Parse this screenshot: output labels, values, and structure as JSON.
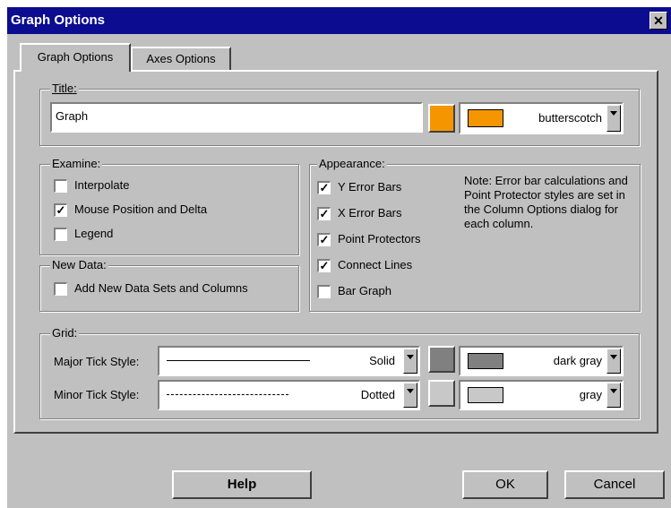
{
  "window": {
    "title": "Graph Options",
    "close_glyph": "✕"
  },
  "tabs": [
    {
      "label": "Graph Options",
      "active": true
    },
    {
      "label": "Axes Options",
      "active": false
    }
  ],
  "title_group": {
    "legend": "Title:",
    "value": "Graph",
    "color_name": "butterscotch",
    "color": "#f59600"
  },
  "examine": {
    "legend": "Examine:",
    "options": [
      {
        "label": "Interpolate",
        "checked": false
      },
      {
        "label": "Mouse Position and Delta",
        "checked": true
      },
      {
        "label": "Legend",
        "checked": false
      }
    ]
  },
  "new_data": {
    "legend": "New Data:",
    "options": [
      {
        "label": "Add New Data Sets and Columns",
        "checked": false
      }
    ]
  },
  "appearance": {
    "legend": "Appearance:",
    "options": [
      {
        "label": "Y Error Bars",
        "checked": true
      },
      {
        "label": "X Error Bars",
        "checked": true
      },
      {
        "label": "Point Protectors",
        "checked": true
      },
      {
        "label": "Connect Lines",
        "checked": true
      },
      {
        "label": "Bar Graph",
        "checked": false
      }
    ],
    "note": "Note:  Error bar calculations and Point Protector styles are set in the Column Options dialog for each column."
  },
  "grid": {
    "legend": "Grid:",
    "major": {
      "label": "Major Tick Style:",
      "style": "Solid",
      "color_name": "dark gray",
      "color": "#808080"
    },
    "minor": {
      "label": "Minor Tick Style:",
      "style": "Dotted",
      "color_name": "gray",
      "color": "#c8c8c8"
    }
  },
  "buttons": {
    "help": "Help",
    "ok": "OK",
    "cancel": "Cancel"
  },
  "check_glyph": "✓"
}
